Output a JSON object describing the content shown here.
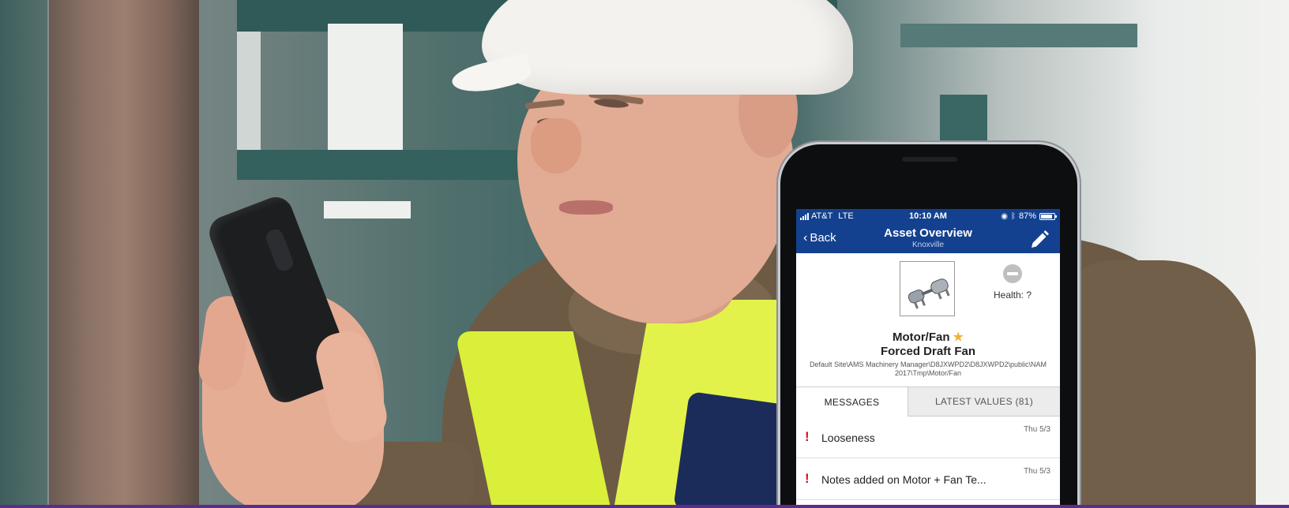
{
  "status_bar": {
    "carrier": "AT&T",
    "network": "LTE",
    "time": "10:10 AM",
    "battery": "87%"
  },
  "nav": {
    "back_label": "Back",
    "title": "Asset Overview",
    "subtitle": "Knoxville",
    "edit_icon": "pencil-icon"
  },
  "asset": {
    "type": "Motor/Fan",
    "favorite": "star-icon",
    "name": "Forced Draft Fan",
    "path": "Default Site\\AMS Machinery Manager\\D8JXWPD2\\D8JXWPD2\\public\\NAM 2017\\Tmp\\Motor/Fan",
    "health_label": "Health: ?"
  },
  "tabs": [
    {
      "label": "MESSAGES",
      "active": true
    },
    {
      "label": "LATEST VALUES (81)",
      "active": false
    }
  ],
  "messages": [
    {
      "text": "Looseness",
      "date": "Thu 5/3"
    },
    {
      "text": "Notes added on Motor + Fan Te...",
      "date": "Thu 5/3"
    }
  ],
  "colors": {
    "nav_bar": "#13418f",
    "alert": "#d0152b",
    "favorite_star": "#f0b23a",
    "bottom_rule": "#5b2d8a"
  }
}
